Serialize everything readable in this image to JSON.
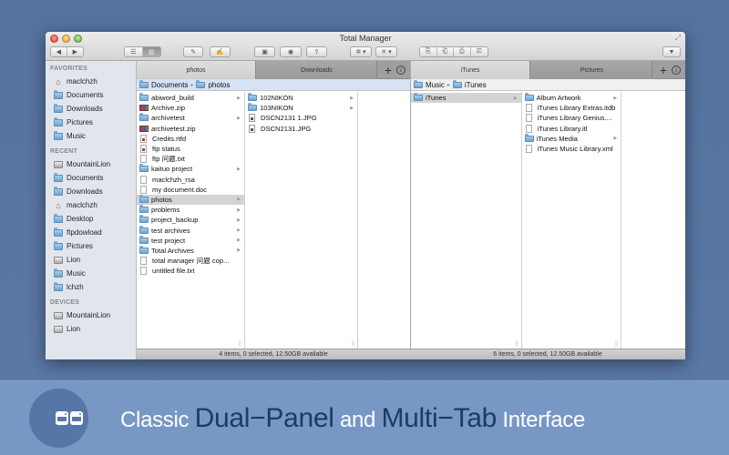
{
  "window": {
    "title": "Total Manager"
  },
  "toolbar": {
    "back_icon": "◀",
    "forward_icon": "▶",
    "list_view_icon": "☰",
    "column_view_icon": "▥",
    "edit_icon": "✎",
    "edit2_icon": "✍",
    "terminal_icon": "▣",
    "quicklook_icon": "◉",
    "share_icon": "⇪",
    "action_icon": "✲ ▾",
    "tools_icon": "✕ ▾",
    "copy_icon": "⎘",
    "move_icon": "⎗",
    "compress_icon": "⎙",
    "extract_icon": "⎚",
    "dropdown_icon": "▼",
    "fullscreen_icon": "⤢"
  },
  "sidebar": {
    "favorites_header": "FAVORITES",
    "favorites": [
      {
        "label": "maclchzh",
        "icon": "home-icon"
      },
      {
        "label": "Documents",
        "icon": "folder-icon"
      },
      {
        "label": "Downloads",
        "icon": "folder-icon"
      },
      {
        "label": "Pictures",
        "icon": "folder-icon"
      },
      {
        "label": "Music",
        "icon": "folder-icon"
      }
    ],
    "recent_header": "RECENT",
    "recent": [
      {
        "label": "MountainLion",
        "icon": "disk-icon"
      },
      {
        "label": "Documents",
        "icon": "folder-icon"
      },
      {
        "label": "Downloads",
        "icon": "folder-icon"
      },
      {
        "label": "maclchzh",
        "icon": "home-icon"
      },
      {
        "label": "Desktop",
        "icon": "folder-icon"
      },
      {
        "label": "ftpdowload",
        "icon": "folder-icon"
      },
      {
        "label": "Pictures",
        "icon": "folder-icon"
      },
      {
        "label": "Lion",
        "icon": "disk-icon"
      },
      {
        "label": "Music",
        "icon": "folder-icon"
      },
      {
        "label": "lchzh",
        "icon": "folder-icon"
      }
    ],
    "devices_header": "DEVICES",
    "devices": [
      {
        "label": "MountainLion",
        "icon": "disk-icon"
      },
      {
        "label": "Lion",
        "icon": "disk-icon"
      }
    ]
  },
  "left_panel": {
    "tabs": [
      {
        "label": "photos",
        "active": true
      },
      {
        "label": "Downloads",
        "active": false
      }
    ],
    "add_tab": "+",
    "info": "i",
    "path": [
      "Documents",
      "photos"
    ],
    "path_sep": "▸",
    "col1": [
      {
        "name": "abiword_build",
        "type": "folder",
        "arrow": true
      },
      {
        "name": "Archive.zip",
        "type": "zip"
      },
      {
        "name": "archivetest",
        "type": "folder",
        "arrow": true
      },
      {
        "name": "archivetest.zip",
        "type": "zip"
      },
      {
        "name": "Credits.rtfd",
        "type": "rtf"
      },
      {
        "name": "ftp status",
        "type": "rtf"
      },
      {
        "name": "ftp 问题.txt",
        "type": "file"
      },
      {
        "name": "kaituo project",
        "type": "folder",
        "arrow": true
      },
      {
        "name": "maclchzh_rsa",
        "type": "file"
      },
      {
        "name": "my document.doc",
        "type": "file"
      },
      {
        "name": "photos",
        "type": "folder",
        "arrow": true,
        "selected": true
      },
      {
        "name": "problems",
        "type": "folder",
        "arrow": true
      },
      {
        "name": "project_backup",
        "type": "folder",
        "arrow": true
      },
      {
        "name": "test archives",
        "type": "folder",
        "arrow": true
      },
      {
        "name": "test project",
        "type": "folder",
        "arrow": true
      },
      {
        "name": "Total Archives",
        "type": "folder",
        "arrow": true
      },
      {
        "name": "total manager 问题 cop...",
        "type": "file"
      },
      {
        "name": "untitled file.txt",
        "type": "file"
      }
    ],
    "col2": [
      {
        "name": "102NIKON",
        "type": "folder",
        "arrow": true
      },
      {
        "name": "103NIKON",
        "type": "folder",
        "arrow": true
      },
      {
        "name": "DSCN2131 1.JPG",
        "type": "jpg"
      },
      {
        "name": "DSCN2131.JPG",
        "type": "jpg"
      }
    ],
    "status": "4 items, 0 selected, 12.50GB available"
  },
  "right_panel": {
    "tabs": [
      {
        "label": "iTunes",
        "active": true
      },
      {
        "label": "Pictures",
        "active": false
      }
    ],
    "add_tab": "+",
    "info": "i",
    "path": [
      "Music",
      "iTunes"
    ],
    "path_sep": "▸",
    "col1": [
      {
        "name": "iTunes",
        "type": "folder",
        "arrow": true,
        "selected": true
      }
    ],
    "col2": [
      {
        "name": "Album Artwork",
        "type": "folder",
        "arrow": true
      },
      {
        "name": "iTunes Library Extras.itdb",
        "type": "file"
      },
      {
        "name": "iTunes Library Genius....",
        "type": "file"
      },
      {
        "name": "iTunes Library.itl",
        "type": "file"
      },
      {
        "name": "iTunes Media",
        "type": "folder",
        "arrow": true
      },
      {
        "name": "iTunes Music Library.xml",
        "type": "file"
      }
    ],
    "status": "6 items, 0 selected, 12.50GB available"
  },
  "banner": {
    "w1": "Classic ",
    "w2": "Dual−Panel",
    "w3": " and ",
    "w4": "Multi−Tab",
    "w5": " Interface"
  },
  "colors": {
    "background": "#5a78a8",
    "banner": "#7797c4",
    "banner_dark_text": "#1d3b66",
    "selection": "#d4d4d4",
    "path_highlight": "#d6e3f3"
  }
}
